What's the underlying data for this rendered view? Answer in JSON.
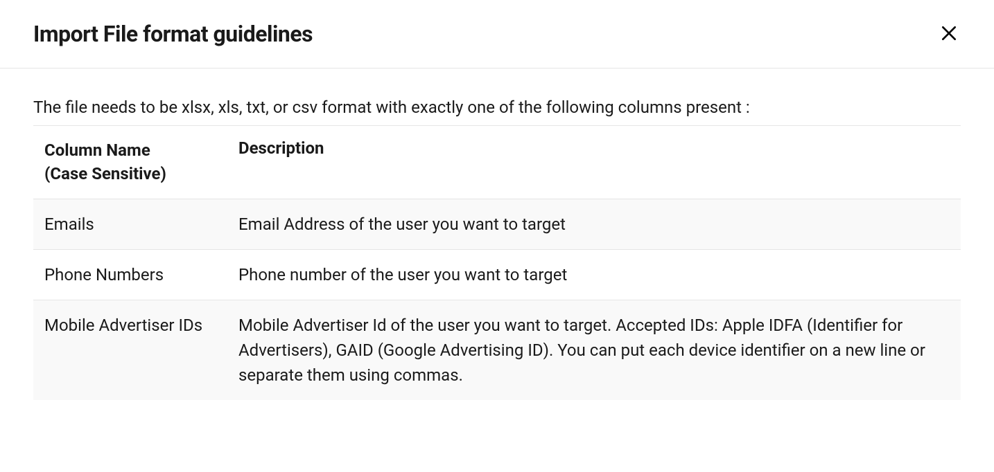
{
  "modal": {
    "title": "Import File format guidelines",
    "intro": "The file needs to be xlsx, xls, txt, or csv format with exactly one of the following columns present :"
  },
  "table": {
    "headers": {
      "col1_line1": "Column Name",
      "col1_line2": "(Case Sensitive)",
      "col2": "Description"
    },
    "rows": [
      {
        "name": "Emails",
        "description": "Email Address of the user you want to target"
      },
      {
        "name": "Phone Numbers",
        "description": "Phone number of the user you want to target"
      },
      {
        "name": "Mobile Advertiser IDs",
        "description": "Mobile Advertiser Id of the user you want to target. Accepted IDs: Apple IDFA (Identifier for Advertisers), GAID (Google Advertising ID). You can put each device identifier on a new line or separate them using commas."
      }
    ]
  }
}
